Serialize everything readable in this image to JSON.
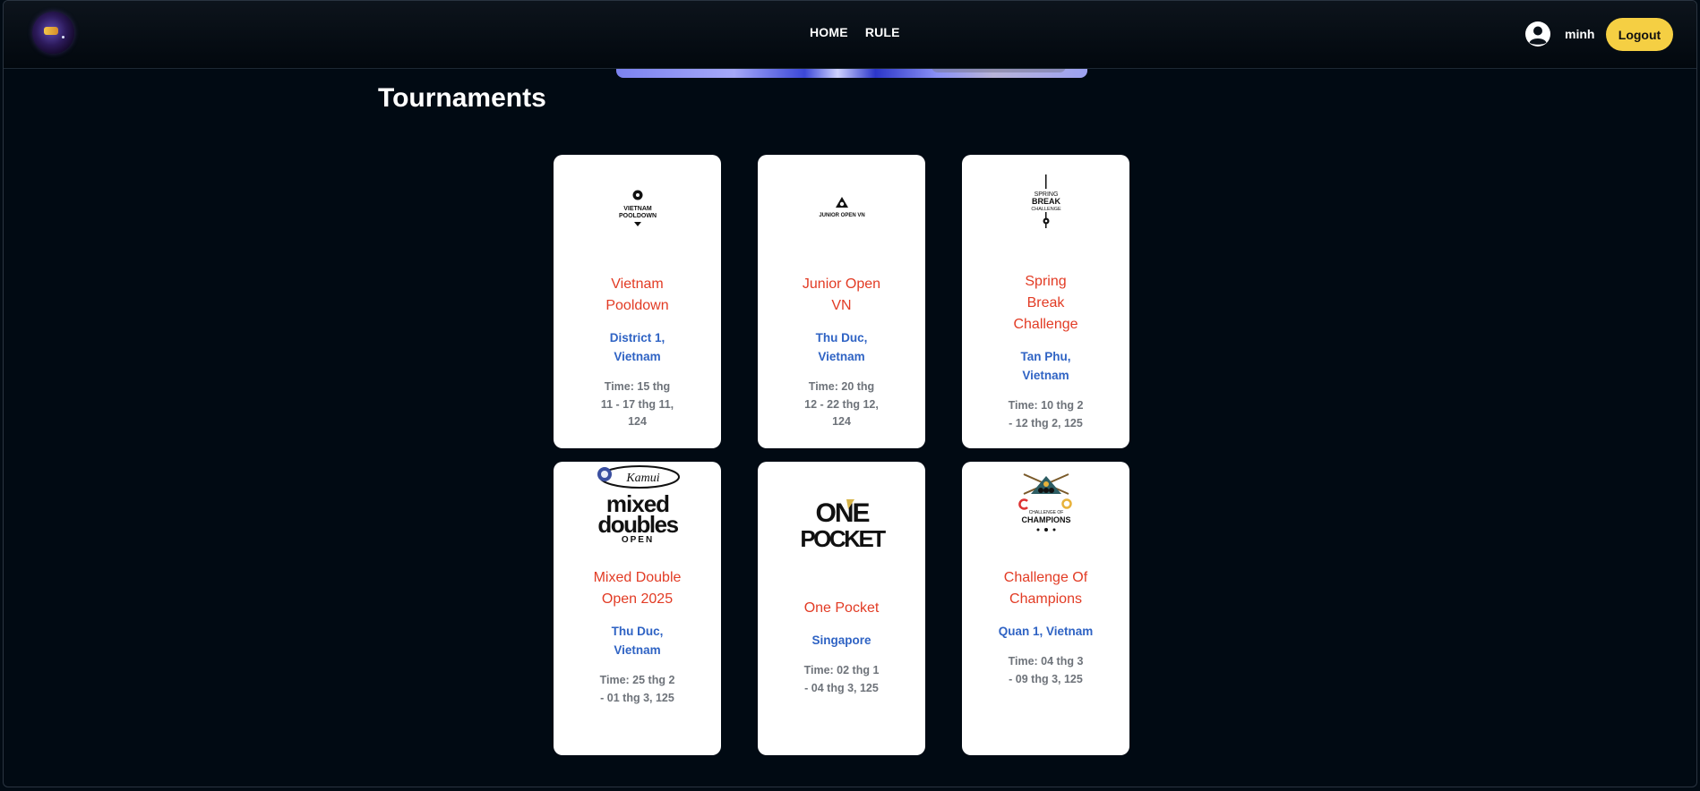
{
  "header": {
    "logo_icon": "site-logo",
    "nav": [
      {
        "label": "HOME"
      },
      {
        "label": "RULE"
      }
    ],
    "user": {
      "icon": "user-circle-icon",
      "name": "minh"
    },
    "logout_label": "Logout",
    "colors": {
      "logout": "#f5cf43",
      "background": "#010a13"
    }
  },
  "page": {
    "title": "Tournaments"
  },
  "tournaments": [
    {
      "name": "Vietnam Pooldown",
      "location": "District 1, Vietnam",
      "time": "Time: 15 thg 11 - 17 thg 11, 124",
      "logo": {
        "text": "VIETNAM POOLDOWN"
      }
    },
    {
      "name": "Junior Open VN",
      "location": "Thu Duc, Vietnam",
      "time": "Time: 20 thg 12 - 22 thg 12, 124",
      "logo": {
        "text": "JUNIOR OPEN VN"
      }
    },
    {
      "name": "Spring Break Challenge",
      "location": "Tan Phu, Vietnam",
      "time": "Time: 10 thg 2 - 12 thg 2, 125",
      "logo": {
        "text": "SPRING BREAK CHALLENGE"
      }
    },
    {
      "name": "Mixed Double Open 2025",
      "location": "Thu Duc, Vietnam",
      "time": "Time: 25 thg 2 - 01 thg 3, 125",
      "logo": {
        "text": "KAMUI mixed doubles OPEN"
      }
    },
    {
      "name": "One Pocket",
      "location": "Singapore",
      "time": "Time: 02 thg 1 - 04 thg 3, 125",
      "logo": {
        "text": "ONE POCKET"
      }
    },
    {
      "name": "Challenge Of Champions",
      "location": "Quan 1, Vietnam",
      "time": "Time: 04 thg 3 - 09 thg 3, 125",
      "logo": {
        "text": "CHALLENGE OF CHAMPIONS"
      }
    }
  ],
  "colors": {
    "name": "#e23b24",
    "location": "#2f63c4",
    "time": "#6e737a"
  }
}
